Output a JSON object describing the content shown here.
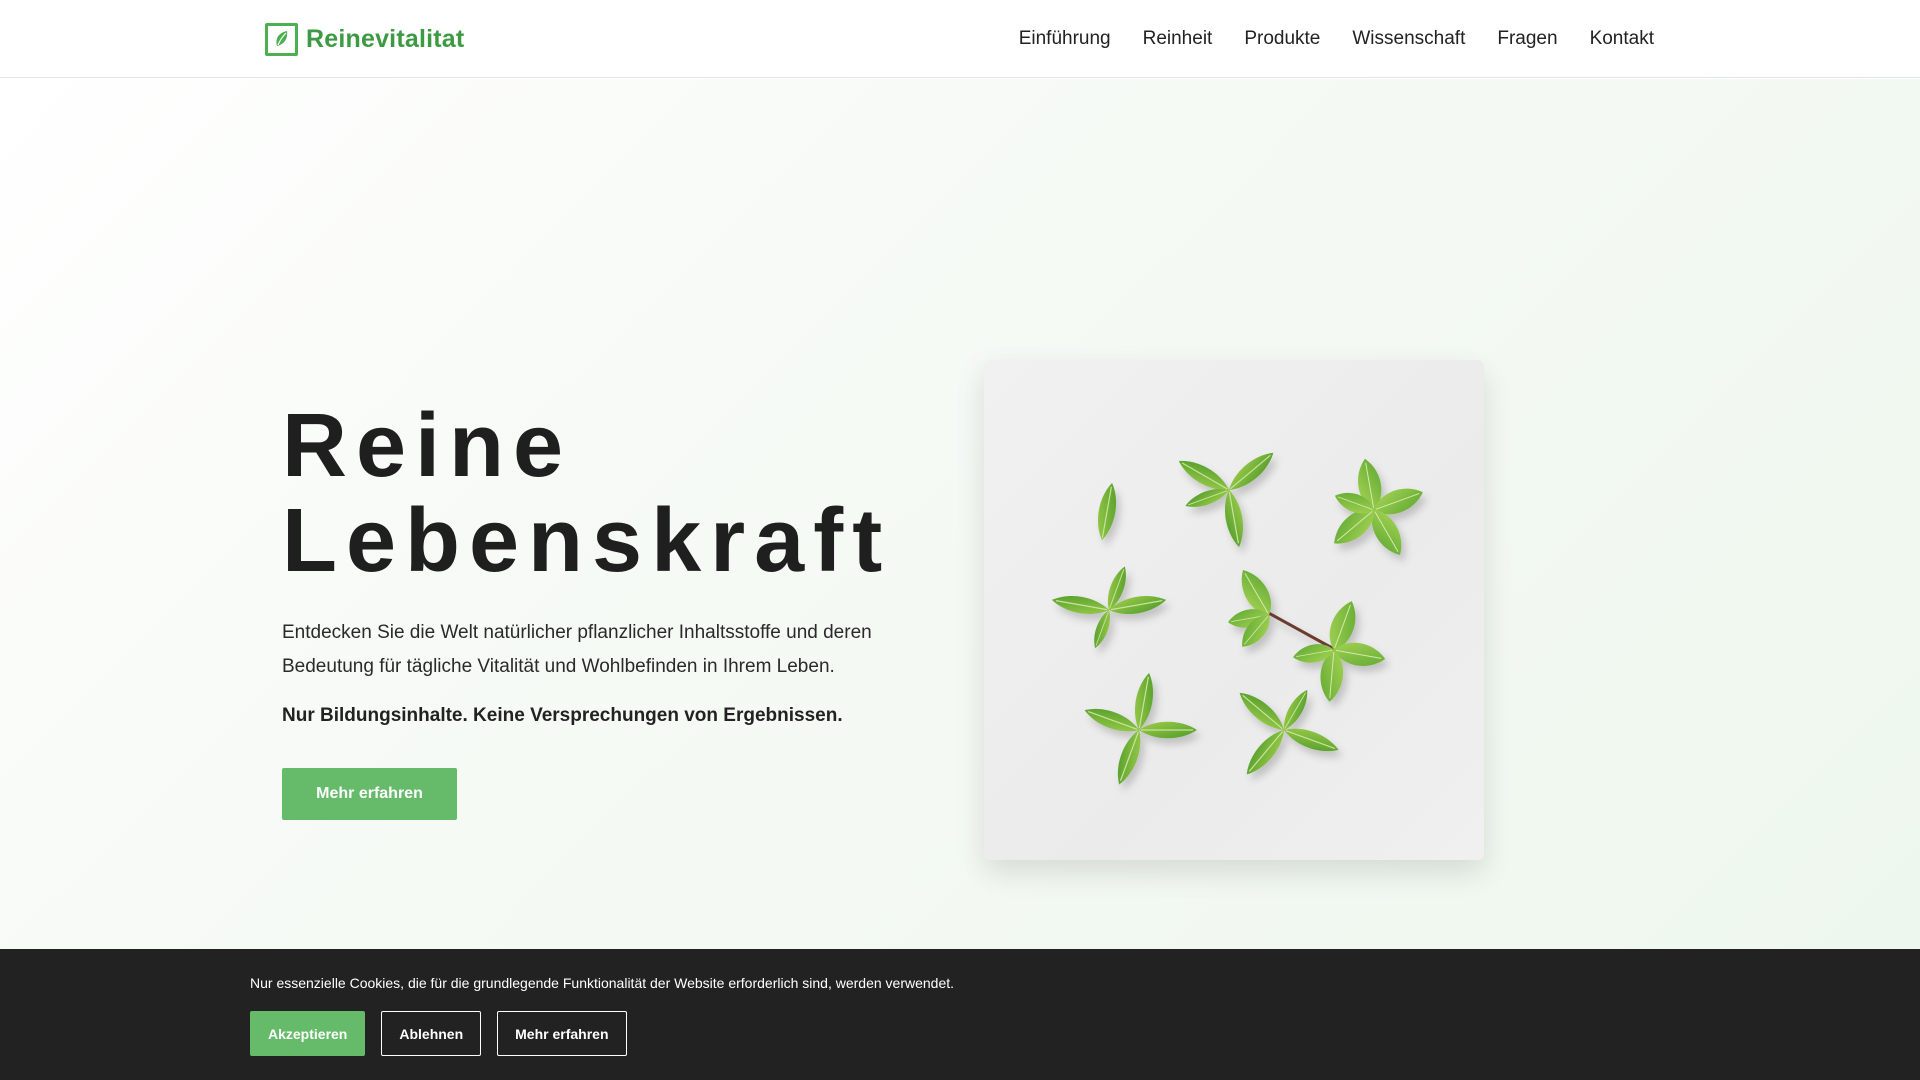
{
  "header": {
    "brand": "Reinevitalitat",
    "nav": [
      "Einführung",
      "Reinheit",
      "Produkte",
      "Wissenschaft",
      "Fragen",
      "Kontakt"
    ]
  },
  "hero": {
    "title_line1": "Reine",
    "title_line2": "Lebenskraft",
    "description": "Entdecken Sie die Welt natürlicher pflanzlicher Inhaltsstoffe und deren Bedeutung für tägliche Vitalität und Wohlbefinden in Ihrem Leben.",
    "disclaimer": "Nur Bildungsinhalte. Keine Versprechungen von Ergebnissen.",
    "cta": "Mehr erfahren"
  },
  "cookie_banner": {
    "text": "Nur essenzielle Cookies, die für die grundlegende Funktionalität der Website erforderlich sind, werden verwendet.",
    "accept": "Akzeptieren",
    "decline": "Ablehnen",
    "more": "Mehr erfahren"
  },
  "icons": {
    "logo": "leaf-icon"
  },
  "colors": {
    "brand": "#3d9a42",
    "accent": "#66bb6a",
    "banner_bg": "#222222"
  }
}
